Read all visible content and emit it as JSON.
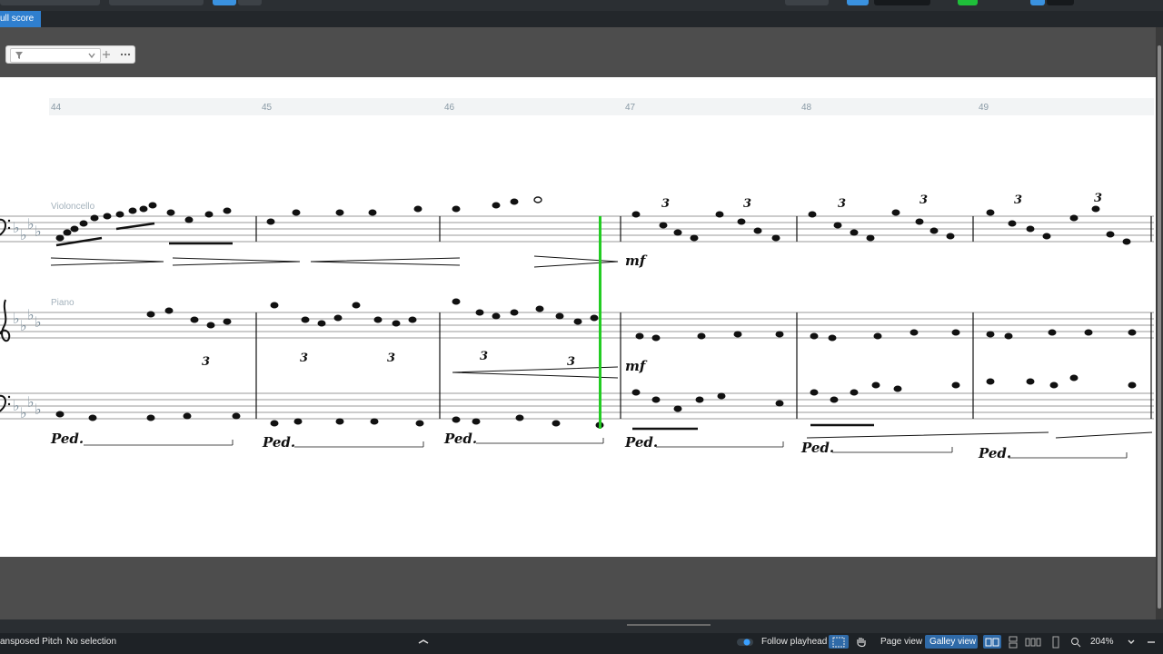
{
  "tabs": {
    "active_label": "ull score"
  },
  "score": {
    "measure_numbers": [
      "44",
      "45",
      "46",
      "47",
      "48",
      "49"
    ],
    "staff_labels": {
      "cello": "Violoncello",
      "piano": "Piano"
    },
    "dynamics": {
      "cello_mf": "mf",
      "piano_mf": "mf"
    },
    "tuplet": "3",
    "pedal": "Ped."
  },
  "status": {
    "pitch_mode": "ansposed Pitch",
    "selection": "No selection",
    "follow_playhead": "Follow playhead",
    "page_view": "Page view",
    "galley_view": "Galley view",
    "zoom": "204%"
  },
  "colors": {
    "accent": "#2f7fcf",
    "playhead": "#22cc22",
    "toggle_on": "#1fbf3a"
  }
}
